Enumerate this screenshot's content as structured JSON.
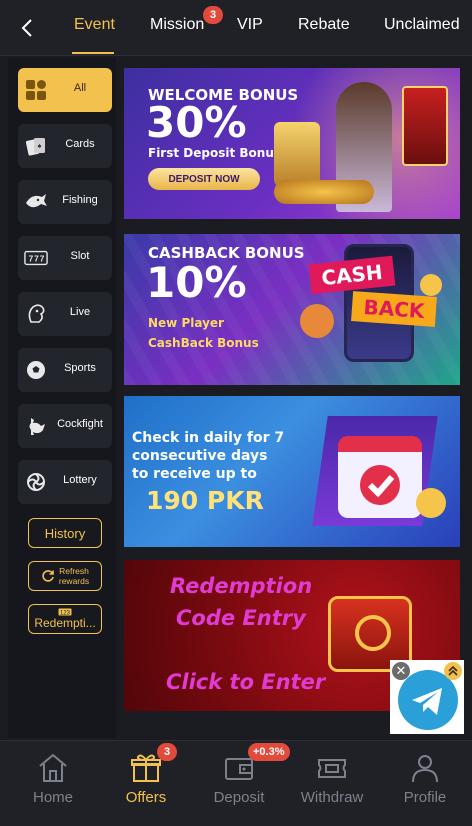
{
  "header": {
    "tabs": [
      {
        "label": "Event",
        "active": true
      },
      {
        "label": "Mission",
        "badge": "3"
      },
      {
        "label": "VIP"
      },
      {
        "label": "Rebate"
      },
      {
        "label": "Unclaimed"
      }
    ]
  },
  "sidebar": {
    "items": [
      {
        "label": "All",
        "icon": "all-grid-icon",
        "active": true
      },
      {
        "label": "Cards",
        "icon": "cards-icon"
      },
      {
        "label": "Fishing",
        "icon": "fishing-icon"
      },
      {
        "label": "Slot",
        "icon": "slot-icon"
      },
      {
        "label": "Live",
        "icon": "live-icon"
      },
      {
        "label": "Sports",
        "icon": "sports-ball-icon"
      },
      {
        "label": "Cockfight",
        "icon": "cockfight-icon"
      },
      {
        "label": "Lottery",
        "icon": "lottery-icon"
      }
    ],
    "history_label": "History",
    "refresh_label_1": "Refresh",
    "refresh_label_2": "rewards",
    "redemption_label": "Redempti..."
  },
  "banners": {
    "welcome": {
      "title": "WELCOME BONUS",
      "amount": "30%",
      "subtitle": "First Deposit Bonus",
      "cta": "DEPOSIT NOW"
    },
    "cashback": {
      "title": "CASHBACK BONUS",
      "amount": "10%",
      "line1": "New Player",
      "line2": "CashBack Bonus",
      "tag1": "CASH",
      "tag2": "BACK"
    },
    "checkin": {
      "line1": "Check in daily for 7",
      "line2": "consecutive days",
      "line3": "to receive up to",
      "amount": "190 PKR"
    },
    "redemption": {
      "line1": "Redemption",
      "line2": "Code Entry",
      "cta": "Click to Enter"
    }
  },
  "bottom_nav": {
    "items": [
      {
        "label": "Home",
        "icon": "home-icon"
      },
      {
        "label": "Offers",
        "icon": "gift-icon",
        "active": true,
        "badge": "3"
      },
      {
        "label": "Deposit",
        "icon": "wallet-icon",
        "badge": "+0.3%"
      },
      {
        "label": "Withdraw",
        "icon": "ticket-icon"
      },
      {
        "label": "Profile",
        "icon": "profile-icon"
      }
    ]
  },
  "colors": {
    "accent": "#f2c14e",
    "badge": "#e24a3b",
    "background": "#1a1c22"
  }
}
